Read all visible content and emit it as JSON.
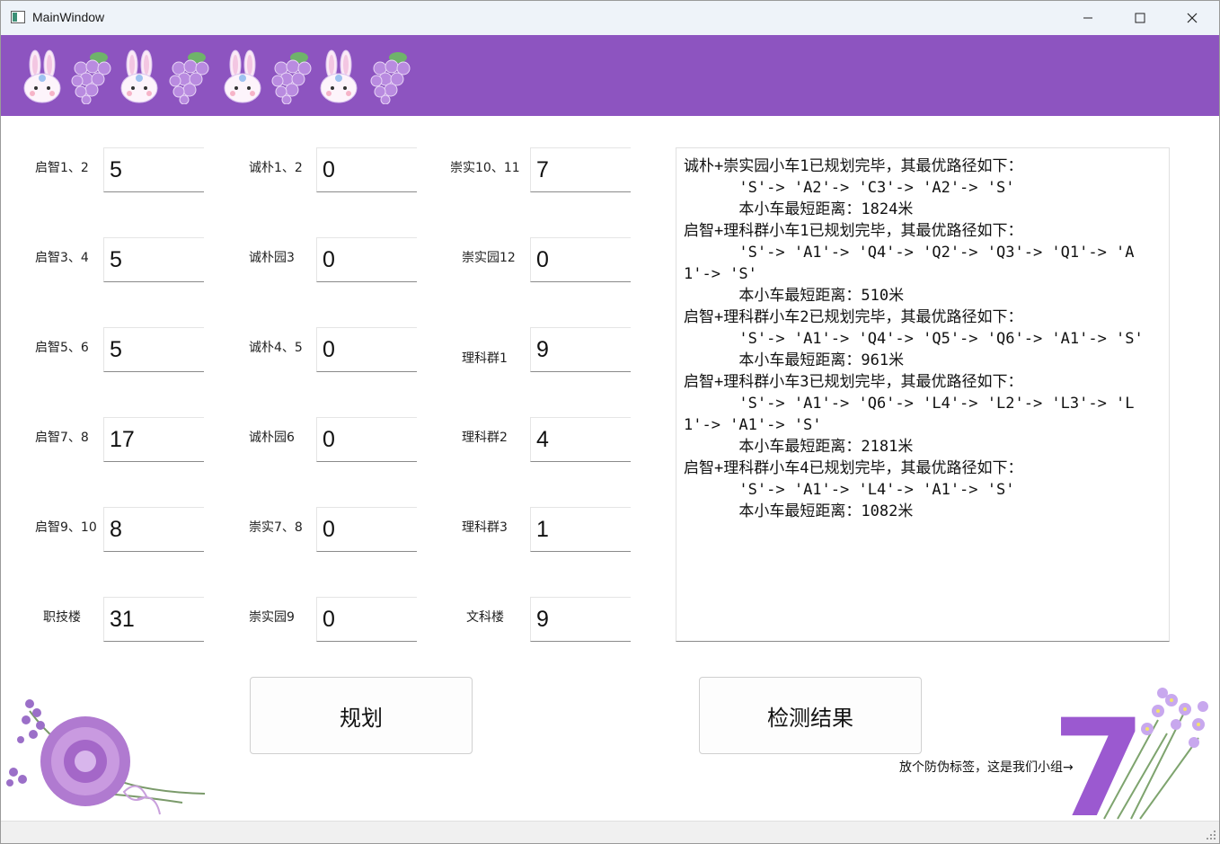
{
  "window": {
    "title": "MainWindow"
  },
  "titlebar_icons": [
    "app-icon",
    "minimize-icon",
    "maximize-icon",
    "close-icon"
  ],
  "colors": {
    "banner": "#8d54c0",
    "titlebar": "#eef3f9",
    "accent_purple": "#9b59d0"
  },
  "banner": {
    "decorations": [
      "bunny",
      "grapes",
      "bunny",
      "grapes",
      "bunny",
      "grapes",
      "bunny",
      "grapes"
    ]
  },
  "fields": [
    {
      "label": "启智1、2",
      "value": "5"
    },
    {
      "label": "启智3、4",
      "value": "5"
    },
    {
      "label": "启智5、6",
      "value": "5"
    },
    {
      "label": "启智7、8",
      "value": "17"
    },
    {
      "label": "启智9、10",
      "value": "8"
    },
    {
      "label": "职技楼",
      "value": "31"
    },
    {
      "label": "诚朴1、2",
      "value": "0"
    },
    {
      "label": "诚朴园3",
      "value": "0"
    },
    {
      "label": "诚朴4、5",
      "value": "0"
    },
    {
      "label": "诚朴园6",
      "value": "0"
    },
    {
      "label": "崇实7、8",
      "value": "0"
    },
    {
      "label": "崇实园9",
      "value": "0"
    },
    {
      "label": "崇实10、11",
      "value": "7"
    },
    {
      "label": "崇实园12",
      "value": "0"
    },
    {
      "label": "理科群1",
      "value": "9"
    },
    {
      "label": "理科群2",
      "value": "4"
    },
    {
      "label": "理科群3",
      "value": "1"
    },
    {
      "label": "文科楼",
      "value": "9"
    }
  ],
  "output": {
    "text": "诚朴+崇实园小车1已规划完毕，其最优路径如下：\n      'S'-> 'A2'-> 'C3'-> 'A2'-> 'S'\n      本小车最短距离：1824米\n启智+理科群小车1已规划完毕，其最优路径如下：\n      'S'-> 'A1'-> 'Q4'-> 'Q2'-> 'Q3'-> 'Q1'-> 'A1'-> 'S'\n      本小车最短距离：510米\n启智+理科群小车2已规划完毕，其最优路径如下：\n      'S'-> 'A1'-> 'Q4'-> 'Q5'-> 'Q6'-> 'A1'-> 'S'\n      本小车最短距离：961米\n启智+理科群小车3已规划完毕，其最优路径如下：\n      'S'-> 'A1'-> 'Q6'-> 'L4'-> 'L2'-> 'L3'-> 'L1'-> 'A1'-> 'S'\n      本小车最短距离：2181米\n启智+理科群小车4已规划完毕，其最优路径如下：\n      'S'-> 'A1'-> 'L4'-> 'A1'-> 'S'\n      本小车最短距离：1082米"
  },
  "buttons": {
    "plan": "规划",
    "check": "检测结果"
  },
  "footer": {
    "watermark": "放个防伪标签，这是我们小组→",
    "logo_digit": "7"
  }
}
